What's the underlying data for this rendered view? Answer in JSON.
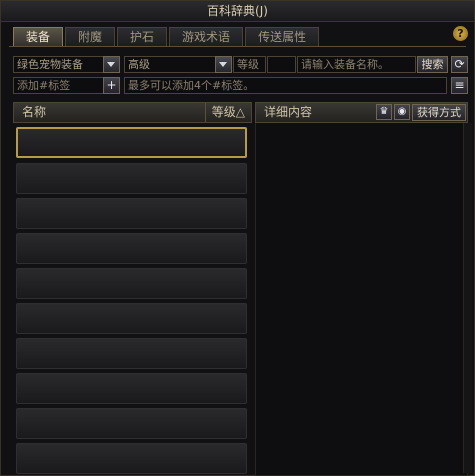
{
  "window": {
    "title": "百科辞典(J)",
    "help_label": "?"
  },
  "tabs": [
    {
      "label": "装备",
      "active": true
    },
    {
      "label": "附魔",
      "active": false
    },
    {
      "label": "护石",
      "active": false
    },
    {
      "label": "游戏术语",
      "active": false
    },
    {
      "label": "传送属性",
      "active": false
    }
  ],
  "filters": {
    "category": "绿色宠物装备",
    "grade": "高级",
    "level_label": "等级",
    "level_value": "",
    "name_placeholder": "请输入装备名称。",
    "search_label": "搜索",
    "refresh_icon": "refresh-icon"
  },
  "tags": {
    "input_placeholder": "添加#标签",
    "add_label": "+",
    "hint": "最多可以添加4个#标签。",
    "list_icon": "list-icon"
  },
  "list": {
    "col_name": "名称",
    "col_level": "等级△",
    "rows": 10
  },
  "detail": {
    "title": "详细内容",
    "acquire_label": "获得方式"
  },
  "colors": {
    "accent": "#b89a4c",
    "panel": "#111114"
  }
}
